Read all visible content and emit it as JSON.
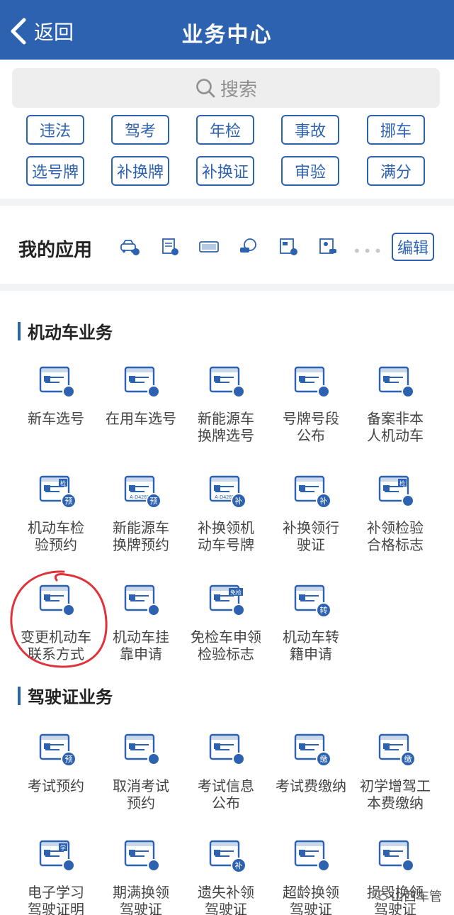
{
  "header": {
    "back_label": "返回",
    "title": "业务中心"
  },
  "search": {
    "label": "搜索"
  },
  "quick_tags": [
    "违法",
    "驾考",
    "年检",
    "事故",
    "挪车",
    "选号牌",
    "补换牌",
    "补换证",
    "审验",
    "满分"
  ],
  "my_apps": {
    "title": "我的应用",
    "edit_label": "编辑",
    "more_label": "•••"
  },
  "vehicle_section": {
    "title": "机动车业务",
    "items": [
      {
        "label": "新车选号",
        "icon": "plate-select-icon"
      },
      {
        "label": "在用车选号",
        "icon": "people-car-icon"
      },
      {
        "label": "新能源车\n换牌选号",
        "icon": "ev-swap-icon"
      },
      {
        "label": "号牌号段\n公布",
        "icon": "plate-range-icon"
      },
      {
        "label": "备案非本\n人机动车",
        "icon": "record-car-icon"
      },
      {
        "label": "机动车检\n验预约",
        "icon": "inspection-booking-icon",
        "badge": "检",
        "corner": "预"
      },
      {
        "label": "新能源车\n换牌预约",
        "icon": "ev-plate-booking-icon",
        "plate": "A·D4265",
        "corner": "预"
      },
      {
        "label": "补换领机\n动车号牌",
        "icon": "replace-plate-icon",
        "plate": "A·D4265",
        "corner": "补"
      },
      {
        "label": "补换领行\n驶证",
        "icon": "replace-license-icon",
        "corner": "补"
      },
      {
        "label": "补领检验\n合格标志",
        "icon": "inspection-mark-icon",
        "badge": "检"
      },
      {
        "label": "变更机动车\n联系方式",
        "icon": "change-contact-icon"
      },
      {
        "label": "机动车挂\n靠申请",
        "icon": "affiliation-icon"
      },
      {
        "label": "免检车申领\n检验标志",
        "icon": "exempt-mark-icon",
        "badge": "免检"
      },
      {
        "label": "机动车转\n籍申请",
        "icon": "transfer-icon",
        "corner": "转"
      }
    ]
  },
  "license_section": {
    "title": "驾驶证业务",
    "items": [
      {
        "label": "考试预约",
        "icon": "exam-booking-icon",
        "corner": "预"
      },
      {
        "label": "取消考试\n预约",
        "icon": "cancel-exam-icon"
      },
      {
        "label": "考试信息\n公布",
        "icon": "exam-info-icon"
      },
      {
        "label": "考试费缴纳",
        "icon": "exam-fee-icon",
        "corner": "缴"
      },
      {
        "label": "初学增驾工\n本费缴纳",
        "icon": "beginner-fee-icon",
        "corner": "缴"
      },
      {
        "label": "电子学习\n驾驶证明",
        "icon": "e-learning-icon",
        "badge": "学"
      },
      {
        "label": "期满换领\n驾驶证",
        "icon": "renew-license-icon"
      },
      {
        "label": "遗失补领\n驾驶证",
        "icon": "lost-license-icon",
        "corner": "补"
      },
      {
        "label": "超龄换领\n驾驶证",
        "icon": "overage-license-icon"
      },
      {
        "label": "损毁换领\n驾驶证",
        "icon": "damaged-license-icon"
      }
    ]
  },
  "watermark": {
    "text": "山西车管"
  },
  "colors": {
    "brand": "#2d62b1",
    "annotation": "#e0323b"
  }
}
